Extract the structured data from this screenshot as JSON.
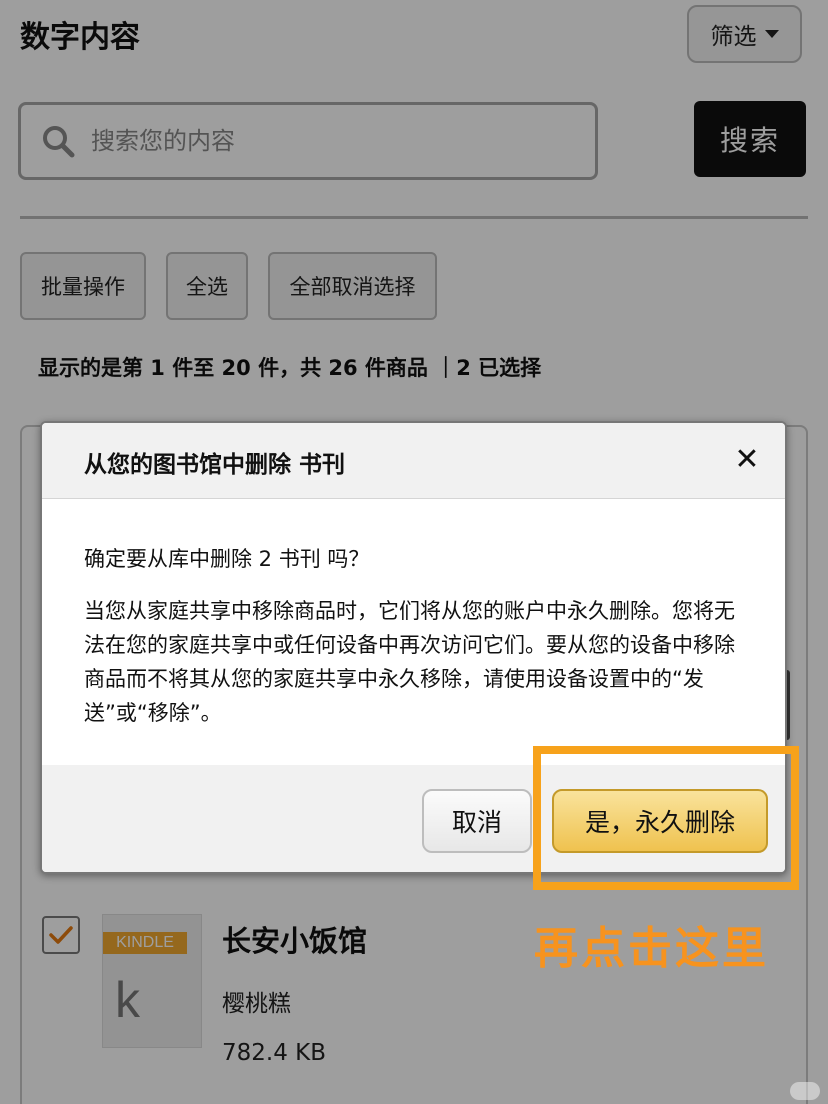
{
  "header": {
    "title": "数字内容",
    "filter_label": "筛选"
  },
  "search": {
    "placeholder": "搜索您的内容",
    "button_label": "搜索"
  },
  "actions": {
    "bulk_label": "批量操作",
    "select_all_label": "全选",
    "deselect_all_label": "全部取消选择"
  },
  "status": {
    "count_text": "显示的是第 1 件至 20 件，共 26 件商品 ｜2 已选择"
  },
  "item": {
    "badge": "KINDLE",
    "cover_letter": "k",
    "title": "长安小饭馆",
    "author": "樱桃糕",
    "size": "782.4 KB",
    "checked": true
  },
  "dialog": {
    "title": "从您的图书馆中删除 书刊",
    "close_label": "✕",
    "question": "确定要从库中删除 2 书刊 吗？",
    "body": "当您从家庭共享中移除商品时，它们将从您的账户中永久删除。您将无法在您的家庭共享中或任何设备中再次访问它们。要从您的设备中移除商品而不将其从您的家庭共享中永久移除，请使用设备设置中的“发送”或“移除”。",
    "cancel_label": "取消",
    "confirm_label": "是，永久删除"
  },
  "annotation": {
    "text": "再点击这里",
    "color": "#f7931e"
  },
  "colors": {
    "accent_button": "#efc24f",
    "search_button": "#111111",
    "badge": "#f0a830"
  }
}
